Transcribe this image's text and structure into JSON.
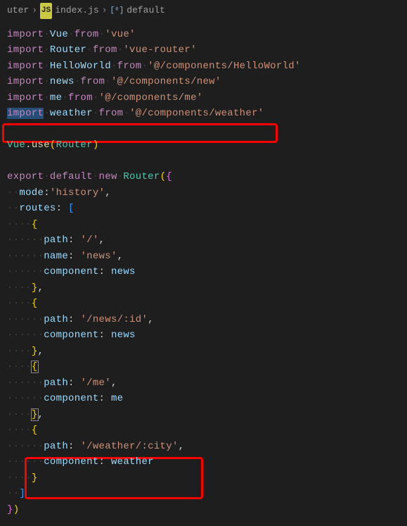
{
  "breadcrumb": {
    "folder": "uter",
    "file": "index.js",
    "symbol": "default",
    "js_label": "JS",
    "sym_label": "⦿"
  },
  "code": {
    "import_kw": "import",
    "from_kw": "from",
    "export_kw": "export",
    "default_kw": "default",
    "new_kw": "new",
    "vue": "Vue",
    "router": "Router",
    "hello": "HelloWorld",
    "news": "news",
    "me": "me",
    "weather": "weather",
    "use": "use",
    "str_vue": "'vue'",
    "str_router": "'vue-router'",
    "str_hello": "'@/components/HelloWorld'",
    "str_new": "'@/components/new'",
    "str_me": "'@/components/me'",
    "str_weather": "'@/components/weather'",
    "mode": "mode",
    "str_history": "'history'",
    "routes": "routes",
    "path": "path",
    "name": "name",
    "component": "component",
    "str_root": "'/'",
    "str_news": "'news'",
    "str_newsid": "'/news/:id'",
    "str_mep": "'/me'",
    "str_weatherp": "'/weather/:city'",
    "dot": "·"
  }
}
